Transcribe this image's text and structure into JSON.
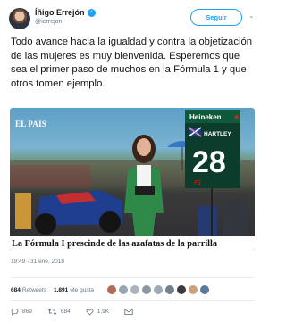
{
  "header": {
    "name": "Íñigo Errejón",
    "handle": "@ierrejon",
    "follow_label": "Seguir",
    "chevron": "⌄"
  },
  "tweet": {
    "text": "Todo avance hacia la igualdad y contra la objetización de las mujeres es muy bienvenida. Esperemos que sea el primer paso de muchos en la Fórmula 1 y que otros tomen ejemplo."
  },
  "media": {
    "source_label": "EL PAIS",
    "headline": "La Fórmula I prescinde de las azafatas de la parrilla",
    "sign_brand": "Heineken",
    "sign_driver": "HARTLEY",
    "sign_number": "28",
    "sign_logo": "F1"
  },
  "timestamp": "19:49 - 31 ene. 2018",
  "stats": {
    "retweets_count": "684",
    "retweets_label": "Retweets",
    "likes_count": "1.891",
    "likes_label": "Me gusta",
    "liker_colors": [
      "#b26b55",
      "#9aa5b1",
      "#aab4be",
      "#8c96a1",
      "#9fa9b3",
      "#6f7f8f",
      "#3b3b3b",
      "#c9a27a",
      "#5b7a99"
    ]
  },
  "actions": {
    "replies": "869",
    "retweets": "684",
    "likes": "1,9K"
  },
  "colors": {
    "accent": "#1da1f2",
    "secondary_text": "#657786",
    "like_red": "#e0245e"
  }
}
